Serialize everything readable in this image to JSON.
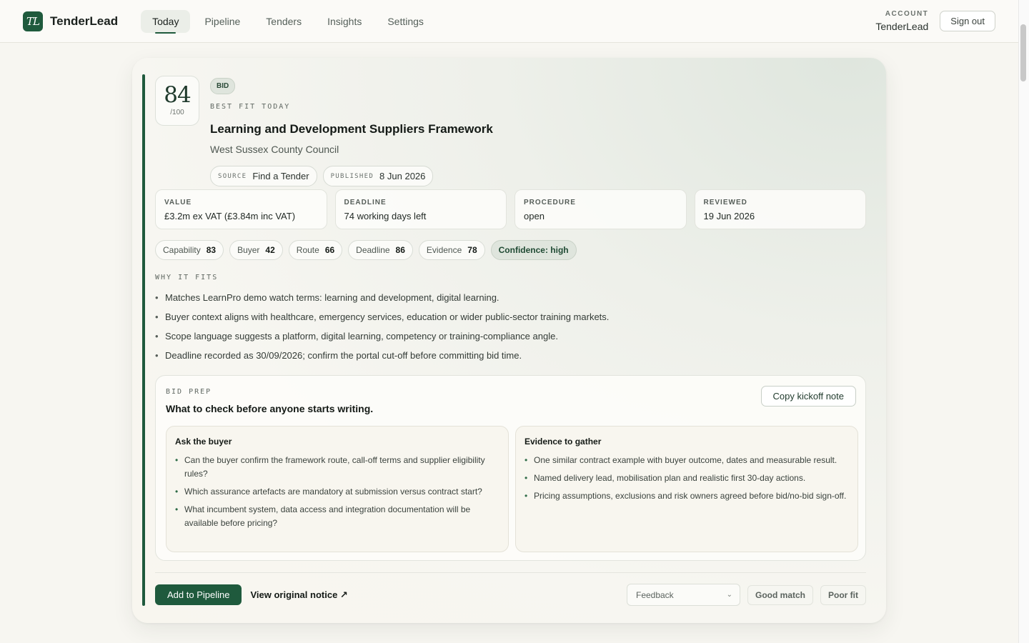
{
  "app": {
    "logo_text": "TL",
    "name": "TenderLead"
  },
  "nav": {
    "tabs": [
      {
        "label": "Today",
        "active": true
      },
      {
        "label": "Pipeline",
        "active": false
      },
      {
        "label": "Tenders",
        "active": false
      },
      {
        "label": "Insights",
        "active": false
      },
      {
        "label": "Settings",
        "active": false
      }
    ]
  },
  "account": {
    "label": "ACCOUNT",
    "name": "TenderLead",
    "sign_out": "Sign out"
  },
  "tender": {
    "score": "84",
    "score_max": "/100",
    "badge": "BID",
    "eyebrow": "BEST FIT TODAY",
    "title": "Learning and Development Suppliers Framework",
    "buyer": "West Sussex County Council",
    "source_label": "SOURCE",
    "source": "Find a Tender",
    "published_label": "PUBLISHED",
    "published": "8 Jun 2026"
  },
  "stats": [
    {
      "label": "VALUE",
      "value": "£3.2m ex VAT (£3.84m inc VAT)"
    },
    {
      "label": "DEADLINE",
      "value": "74 working days left"
    },
    {
      "label": "PROCEDURE",
      "value": "open"
    },
    {
      "label": "REVIEWED",
      "value": "19 Jun 2026"
    }
  ],
  "scores": [
    {
      "label": "Capability",
      "value": "83"
    },
    {
      "label": "Buyer",
      "value": "42"
    },
    {
      "label": "Route",
      "value": "66"
    },
    {
      "label": "Deadline",
      "value": "86"
    },
    {
      "label": "Evidence",
      "value": "78"
    }
  ],
  "confidence": "Confidence: high",
  "why": {
    "label": "WHY IT FITS",
    "items": [
      "Matches LearnPro demo watch terms: learning and development, digital learning.",
      "Buyer context aligns with healthcare, emergency services, education or wider public-sector training markets.",
      "Scope language suggests a platform, digital learning, competency or training-compliance angle.",
      "Deadline recorded as 30/09/2026; confirm the portal cut-off before committing bid time."
    ]
  },
  "prep": {
    "eyebrow": "BID PREP",
    "title": "What to check before anyone starts writing.",
    "copy_button": "Copy kickoff note",
    "ask_title": "Ask the buyer",
    "ask_items": [
      "Can the buyer confirm the framework route, call-off terms and supplier eligibility rules?",
      "Which assurance artefacts are mandatory at submission versus contract start?",
      "What incumbent system, data access and integration documentation will be available before pricing?"
    ],
    "evidence_title": "Evidence to gather",
    "evidence_items": [
      "One similar contract example with buyer outcome, dates and measurable result.",
      "Named delivery lead, mobilisation plan and realistic first 30-day actions.",
      "Pricing assumptions, exclusions and risk owners agreed before bid/no-bid sign-off."
    ]
  },
  "actions": {
    "add_pipeline": "Add to Pipeline",
    "view_notice": "View original notice ↗",
    "feedback_selected": "Feedback",
    "good_match": "Good match",
    "poor_fit": "Poor fit"
  }
}
